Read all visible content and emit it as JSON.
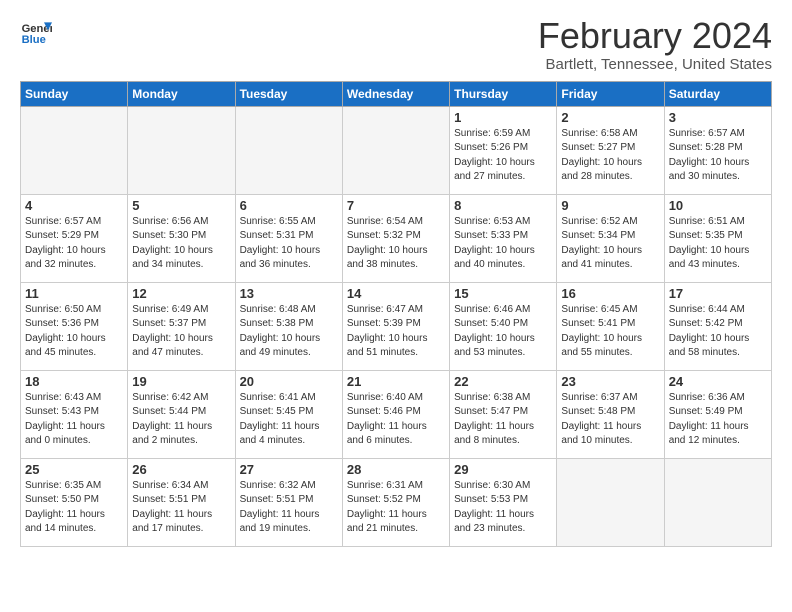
{
  "header": {
    "logo_line1": "General",
    "logo_line2": "Blue",
    "title": "February 2024",
    "subtitle": "Bartlett, Tennessee, United States"
  },
  "days_of_week": [
    "Sunday",
    "Monday",
    "Tuesday",
    "Wednesday",
    "Thursday",
    "Friday",
    "Saturday"
  ],
  "weeks": [
    [
      {
        "day": "",
        "info": ""
      },
      {
        "day": "",
        "info": ""
      },
      {
        "day": "",
        "info": ""
      },
      {
        "day": "",
        "info": ""
      },
      {
        "day": "1",
        "info": "Sunrise: 6:59 AM\nSunset: 5:26 PM\nDaylight: 10 hours\nand 27 minutes."
      },
      {
        "day": "2",
        "info": "Sunrise: 6:58 AM\nSunset: 5:27 PM\nDaylight: 10 hours\nand 28 minutes."
      },
      {
        "day": "3",
        "info": "Sunrise: 6:57 AM\nSunset: 5:28 PM\nDaylight: 10 hours\nand 30 minutes."
      }
    ],
    [
      {
        "day": "4",
        "info": "Sunrise: 6:57 AM\nSunset: 5:29 PM\nDaylight: 10 hours\nand 32 minutes."
      },
      {
        "day": "5",
        "info": "Sunrise: 6:56 AM\nSunset: 5:30 PM\nDaylight: 10 hours\nand 34 minutes."
      },
      {
        "day": "6",
        "info": "Sunrise: 6:55 AM\nSunset: 5:31 PM\nDaylight: 10 hours\nand 36 minutes."
      },
      {
        "day": "7",
        "info": "Sunrise: 6:54 AM\nSunset: 5:32 PM\nDaylight: 10 hours\nand 38 minutes."
      },
      {
        "day": "8",
        "info": "Sunrise: 6:53 AM\nSunset: 5:33 PM\nDaylight: 10 hours\nand 40 minutes."
      },
      {
        "day": "9",
        "info": "Sunrise: 6:52 AM\nSunset: 5:34 PM\nDaylight: 10 hours\nand 41 minutes."
      },
      {
        "day": "10",
        "info": "Sunrise: 6:51 AM\nSunset: 5:35 PM\nDaylight: 10 hours\nand 43 minutes."
      }
    ],
    [
      {
        "day": "11",
        "info": "Sunrise: 6:50 AM\nSunset: 5:36 PM\nDaylight: 10 hours\nand 45 minutes."
      },
      {
        "day": "12",
        "info": "Sunrise: 6:49 AM\nSunset: 5:37 PM\nDaylight: 10 hours\nand 47 minutes."
      },
      {
        "day": "13",
        "info": "Sunrise: 6:48 AM\nSunset: 5:38 PM\nDaylight: 10 hours\nand 49 minutes."
      },
      {
        "day": "14",
        "info": "Sunrise: 6:47 AM\nSunset: 5:39 PM\nDaylight: 10 hours\nand 51 minutes."
      },
      {
        "day": "15",
        "info": "Sunrise: 6:46 AM\nSunset: 5:40 PM\nDaylight: 10 hours\nand 53 minutes."
      },
      {
        "day": "16",
        "info": "Sunrise: 6:45 AM\nSunset: 5:41 PM\nDaylight: 10 hours\nand 55 minutes."
      },
      {
        "day": "17",
        "info": "Sunrise: 6:44 AM\nSunset: 5:42 PM\nDaylight: 10 hours\nand 58 minutes."
      }
    ],
    [
      {
        "day": "18",
        "info": "Sunrise: 6:43 AM\nSunset: 5:43 PM\nDaylight: 11 hours\nand 0 minutes."
      },
      {
        "day": "19",
        "info": "Sunrise: 6:42 AM\nSunset: 5:44 PM\nDaylight: 11 hours\nand 2 minutes."
      },
      {
        "day": "20",
        "info": "Sunrise: 6:41 AM\nSunset: 5:45 PM\nDaylight: 11 hours\nand 4 minutes."
      },
      {
        "day": "21",
        "info": "Sunrise: 6:40 AM\nSunset: 5:46 PM\nDaylight: 11 hours\nand 6 minutes."
      },
      {
        "day": "22",
        "info": "Sunrise: 6:38 AM\nSunset: 5:47 PM\nDaylight: 11 hours\nand 8 minutes."
      },
      {
        "day": "23",
        "info": "Sunrise: 6:37 AM\nSunset: 5:48 PM\nDaylight: 11 hours\nand 10 minutes."
      },
      {
        "day": "24",
        "info": "Sunrise: 6:36 AM\nSunset: 5:49 PM\nDaylight: 11 hours\nand 12 minutes."
      }
    ],
    [
      {
        "day": "25",
        "info": "Sunrise: 6:35 AM\nSunset: 5:50 PM\nDaylight: 11 hours\nand 14 minutes."
      },
      {
        "day": "26",
        "info": "Sunrise: 6:34 AM\nSunset: 5:51 PM\nDaylight: 11 hours\nand 17 minutes."
      },
      {
        "day": "27",
        "info": "Sunrise: 6:32 AM\nSunset: 5:51 PM\nDaylight: 11 hours\nand 19 minutes."
      },
      {
        "day": "28",
        "info": "Sunrise: 6:31 AM\nSunset: 5:52 PM\nDaylight: 11 hours\nand 21 minutes."
      },
      {
        "day": "29",
        "info": "Sunrise: 6:30 AM\nSunset: 5:53 PM\nDaylight: 11 hours\nand 23 minutes."
      },
      {
        "day": "",
        "info": ""
      },
      {
        "day": "",
        "info": ""
      }
    ]
  ]
}
